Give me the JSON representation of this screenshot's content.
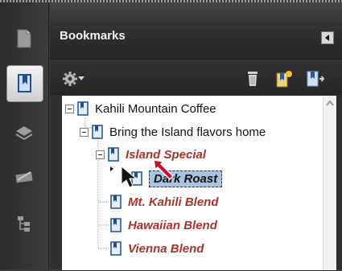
{
  "panel": {
    "title": "Bookmarks"
  },
  "toolbar": {
    "options_icon": "gear-icon",
    "delete_icon": "trash-icon",
    "new_icon": "new-bookmark-icon",
    "expand_icon": "expand-bookmark-icon"
  },
  "bookmarks": {
    "root": "Kahili Mountain Coffee",
    "child": "Bring the Island flavors home",
    "island_special": "Island Special",
    "dark_roast": "Dark Roast",
    "mt_kahili": "Mt. Kahili Blend",
    "hawaiian": "Hawaiian Blend",
    "vienna": "Vienna Blend"
  },
  "colors": {
    "accent_text": "#a8342b",
    "selection": "#a9c4e0",
    "cursor_accent": "#c8102e"
  }
}
